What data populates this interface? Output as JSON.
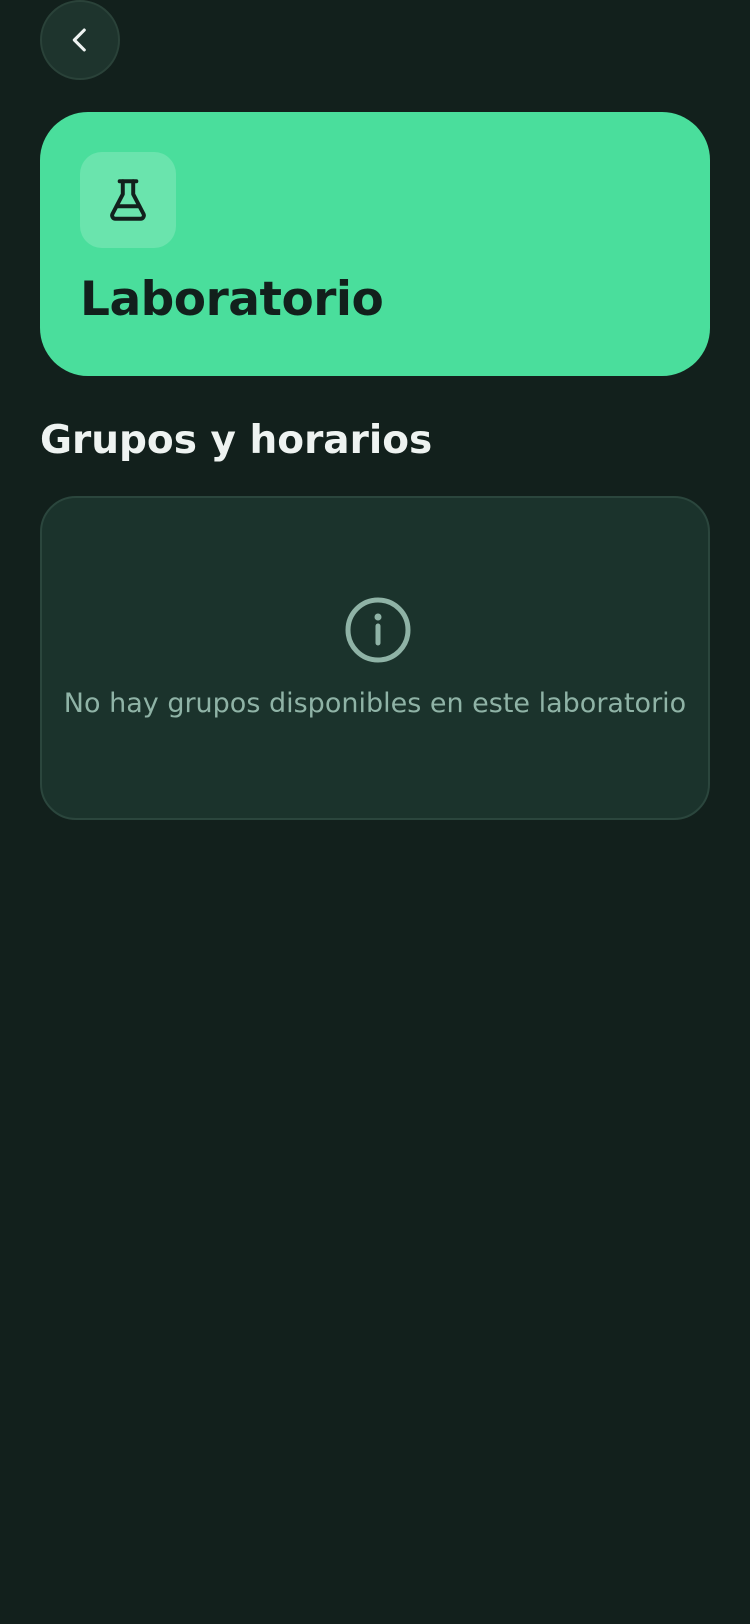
{
  "header": {
    "back_icon": "chevron-left-icon"
  },
  "hero": {
    "icon": "flask-icon",
    "title": "Laboratorio",
    "accent_color": "#4ade9c"
  },
  "groups_section": {
    "title": "Grupos y horarios",
    "empty_state": {
      "icon": "info-icon",
      "message": "No hay grupos disponibles en este laboratorio"
    }
  },
  "theme": {
    "background": "#12201c",
    "card_background": "#1b332c",
    "muted_text": "#8fb3a6"
  }
}
